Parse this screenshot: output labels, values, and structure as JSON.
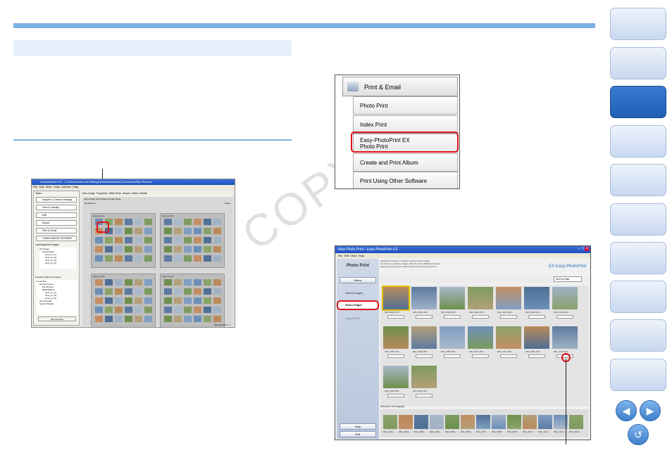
{
  "page": {
    "watermark": "COPY"
  },
  "sidebar_tabs": {
    "count": 10,
    "active_index": 2
  },
  "nav": {
    "prev_icon": "left-arrow-icon",
    "next_icon": "right-arrow-icon",
    "back_icon": "return-icon"
  },
  "colors": {
    "accent": "#7fb0e4",
    "highlight": "#e0101a",
    "active_tab": "#2a6cc4"
  },
  "shot1": {
    "title": "ZoomBrowser EX - C:\\Documents and Settings\\Administrator\\My Documents\\My Pictures",
    "menu": [
      "File",
      "Edit",
      "View",
      "Tools",
      "Internet",
      "Help"
    ],
    "tasks_header": "Tasks",
    "tasks": [
      "Acquire & Camera Settings",
      "View & Classify",
      "Edit",
      "Export",
      "Print & Email",
      "CANON iMAGE GATEWAY"
    ],
    "lastacquired_header": "Last Acquired Images",
    "tree": [
      "All Images",
      "Downloaded",
      "view_on_01",
      "view_on_02",
      "view_on_03",
      "view_on_04"
    ],
    "favorites_tabs": [
      "Favorite Folders",
      "All Folders"
    ],
    "tree2": [
      "Local disk",
      "My Documents",
      "My Pictures",
      "RAW/Shared",
      "view_on_01",
      "view_on_02",
      "view_on_03",
      "My Computer",
      "Search Results"
    ],
    "edit_favorites": "Edit Favorites",
    "toolbar": [
      "New Image",
      "Properties",
      "Slide Show",
      "Search",
      "Select",
      "Rotate"
    ],
    "view_tabs": [
      "Zoom Mode",
      "Scroll Mode",
      "Preview Mode"
    ],
    "breadcrumb": "My Pictures",
    "filter": "Filters",
    "panels": [
      "view_on_01",
      "view_on_02",
      "view_on_03",
      "view_on_04"
    ],
    "status": "Selected items: 1"
  },
  "shot2": {
    "head": "Print & Email",
    "items": [
      "Photo Print",
      "Index Print",
      "Easy-PhotoPrint EX Photo Print",
      "Create and Print Album",
      "Print Using Other Software"
    ],
    "highlighted_index": 2
  },
  "shot3": {
    "title": "New Photo Print - Easy-PhotoPrint EX",
    "menu": [
      "File",
      "Edit",
      "View",
      "Help"
    ],
    "heading": "Photo Print",
    "instructions": [
      "Specify the number of copies to print for each image.",
      "To correct or enhance images, click the Correct/Enhance button.",
      "Apply corrections and enhancements in the resulting screen."
    ],
    "logo": "Easy-PhotoPrint",
    "logo_sub": "EX",
    "menu_btn": "Menu",
    "steps": [
      "Select Images",
      "Select Paper",
      "Layout/Print"
    ],
    "active_step": "Select Paper",
    "sort": "Sort by Date",
    "selected": "Selected: 16 image(s)",
    "captions": [
      "IMG_0003.JPG",
      "IMG_0004.JPG",
      "IMG_0005.JPG",
      "IMG_0006.JPG",
      "IMG_0007.JPG",
      "IMG_0008.JPG",
      "IMG_0009.JPG",
      "IMG_0010.JPG",
      "IMG_0005.JPG",
      "IMG_0009.JPG",
      "IMG_0010.JPG",
      "IMG_0011.JPG",
      "IMG_0012.JPG",
      "IMG_0013.JPG",
      "IMG_0014.JPG",
      "IMG_0015.JPG",
      "IMG_0016.JPG"
    ],
    "strip_captions": [
      "IMG_0001...",
      "IMG_0002...",
      "IMG_0003...",
      "IMG_0004...",
      "IMG_0005...",
      "IMG_0006...",
      "IMG_0007...",
      "IMG_0008...",
      "IMG_0009...",
      "IMG_0010...",
      "IMG_0011...",
      "IMG_0012...",
      "IMG_0013..."
    ],
    "help": "Help",
    "exit": "Exit"
  }
}
